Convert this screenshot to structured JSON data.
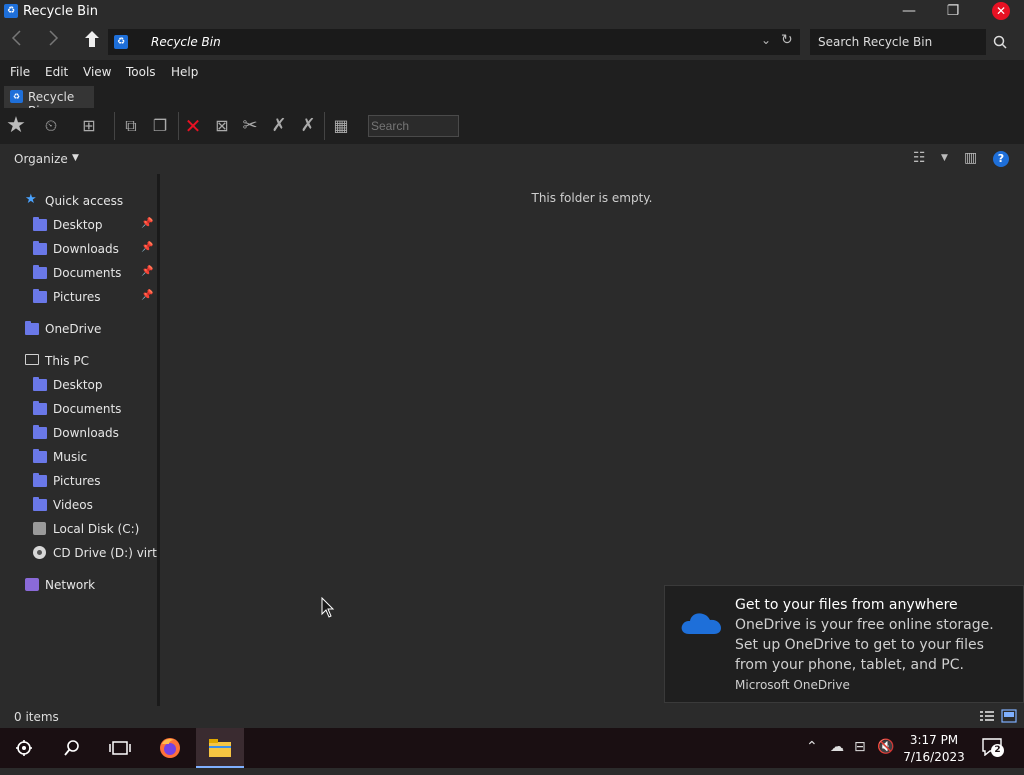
{
  "window": {
    "title": "Recycle Bin",
    "minimize_glyph": "—",
    "restore_glyph": "❐",
    "close_glyph": "✕"
  },
  "address": {
    "path": "Recycle Bin",
    "search_placeholder": "Search Recycle Bin"
  },
  "menu": [
    "File",
    "Edit",
    "View",
    "Tools",
    "Help"
  ],
  "tab": {
    "label": "Recycle Bin"
  },
  "toolbar": {
    "search_placeholder": "Search"
  },
  "command_bar": {
    "organize_label": "Organize"
  },
  "sidebar": {
    "quick_access": {
      "label": "Quick access",
      "items": [
        "Desktop",
        "Downloads",
        "Documents",
        "Pictures"
      ]
    },
    "onedrive": "OneDrive",
    "this_pc": {
      "label": "This PC",
      "items": [
        "Desktop",
        "Documents",
        "Downloads",
        "Music",
        "Pictures",
        "Videos"
      ],
      "local_disk": "Local Disk (C:)",
      "cd_drive": "CD Drive (D:) virtio"
    },
    "network": "Network"
  },
  "content": {
    "empty_message": "This folder is empty."
  },
  "status": {
    "item_count": "0 items"
  },
  "toast": {
    "title": "Get to your files from anywhere",
    "body": "OneDrive is your free online storage. Set up OneDrive to get to your files from your phone, tablet, and PC.",
    "source": "Microsoft OneDrive"
  },
  "taskbar": {
    "time": "3:17 PM",
    "date": "7/16/2023",
    "notification_count": "2"
  },
  "colors": {
    "accent": "#1e6fd9",
    "folder": "#6a78e8",
    "close": "#e81123",
    "background": "#2b2b2b"
  }
}
